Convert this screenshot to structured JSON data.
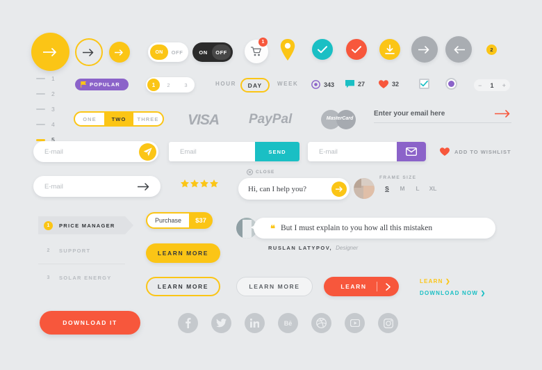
{
  "meta": {
    "kit_title": "Flat UI Kit Components",
    "colors": {
      "yellow": "#fbc516",
      "red": "#f7573c",
      "teal": "#1abfc4",
      "purple": "#8b63c9",
      "grey": "#a9adb2",
      "background": "#e8eaec"
    }
  },
  "row_arrows": {
    "arrow_big": "arrow-right-icon",
    "arrow_outline": "arrow-right-icon",
    "arrow_small": "arrow-right-icon"
  },
  "toggles": [
    {
      "name": "toggle-light",
      "on_label": "ON",
      "off_label": "OFF",
      "state": "on",
      "style": "light"
    },
    {
      "name": "toggle-dark",
      "on_label": "ON",
      "off_label": "OFF",
      "state": "off",
      "style": "dark"
    }
  ],
  "cart": {
    "icon": "shopping-cart-icon",
    "badge": "1"
  },
  "round_icons": [
    {
      "name": "map-pin-icon",
      "color": "#fbc516"
    },
    {
      "name": "check-icon",
      "color": "#1abfc4"
    },
    {
      "name": "check-icon",
      "color": "#f7573c"
    },
    {
      "name": "download-icon",
      "color": "#fbc516"
    },
    {
      "name": "arrow-right-icon",
      "color": "#a9adb2"
    },
    {
      "name": "arrow-left-icon",
      "color": "#a9adb2"
    }
  ],
  "notification_badge": {
    "count": "2"
  },
  "vertical_pager": {
    "items": [
      {
        "label": "1",
        "active": false
      },
      {
        "label": "2",
        "active": false
      },
      {
        "label": "3",
        "active": false
      },
      {
        "label": "4",
        "active": false
      },
      {
        "label": "5",
        "active": true
      }
    ]
  },
  "popular_badge": {
    "label": "POPULAR",
    "icon": "flag-icon"
  },
  "pagination": {
    "current": "1",
    "pages": [
      "2",
      "3"
    ]
  },
  "period_tabs": {
    "items": [
      {
        "label": "HOUR",
        "active": false
      },
      {
        "label": "DAY",
        "active": true
      },
      {
        "label": "WEEK",
        "active": false
      }
    ]
  },
  "stats": [
    {
      "icon": "eye-icon",
      "value": "343",
      "color": "#8b63c9"
    },
    {
      "icon": "comment-icon",
      "value": "27",
      "color": "#1abfc4"
    },
    {
      "icon": "heart-icon",
      "value": "32",
      "color": "#f7573c"
    }
  ],
  "checkbox": {
    "name": "checkbox",
    "checked": true
  },
  "radio": {
    "name": "radio-button",
    "checked": true
  },
  "stepper": {
    "minus": "−",
    "value": "1",
    "plus": "+"
  },
  "segmented": {
    "items": [
      {
        "label": "ONE",
        "active": false
      },
      {
        "label": "TWO",
        "active": true
      },
      {
        "label": "THREE",
        "active": false
      }
    ]
  },
  "payment_logos": [
    {
      "name": "visa-logo",
      "label": "VISA"
    },
    {
      "name": "paypal-logo",
      "label": "PayPal"
    },
    {
      "name": "mastercard-logo",
      "label": "MasterCard"
    }
  ],
  "email_underline": {
    "placeholder": "Enter your email here",
    "submit_icon": "arrow-right-icon"
  },
  "inputs": [
    {
      "name": "email-input-pill",
      "placeholder": "E-mail",
      "button": "send-plane-icon"
    },
    {
      "name": "email-input-send",
      "placeholder": "Email",
      "button_label": "SEND"
    },
    {
      "name": "email-input-envelope",
      "placeholder": "E-mail",
      "button": "envelope-icon"
    },
    {
      "name": "email-input-arrow",
      "placeholder": "E-mail",
      "button": "arrow-right-icon"
    }
  ],
  "wishlist": {
    "label": "ADD TO WISHLIST",
    "icon": "heart-icon"
  },
  "rating": {
    "stars_filled": 4,
    "stars_total": 4
  },
  "chat": {
    "close_label": "CLOSE",
    "close_icon": "close-circle-icon",
    "message": "Hi, can I help you?",
    "submit_icon": "arrow-right-icon"
  },
  "frame_size": {
    "title": "FRAME SIZE",
    "options": [
      {
        "label": "S",
        "active": true
      },
      {
        "label": "M",
        "active": false
      },
      {
        "label": "L",
        "active": false
      },
      {
        "label": "XL",
        "active": false
      }
    ]
  },
  "nav": {
    "items": [
      {
        "number": "1",
        "label": "PRICE MANAGER",
        "active": true
      },
      {
        "number": "2",
        "label": "SUPPORT",
        "active": false
      },
      {
        "number": "3",
        "label": "SOLAR ENERGY",
        "active": false
      }
    ]
  },
  "purchase": {
    "label": "Purchase",
    "price": "$37"
  },
  "buttons": [
    {
      "name": "learn-more-solid",
      "label": "LEARN MORE",
      "style": "solid-yellow"
    },
    {
      "name": "learn-more-outline",
      "label": "LEARN MORE",
      "style": "outline-yellow"
    },
    {
      "name": "learn-more-ghost",
      "label": "LEARN MORE",
      "style": "grey"
    },
    {
      "name": "learn-split",
      "label": "LEARN",
      "style": "solid-red",
      "icon": "chevron-right-icon"
    }
  ],
  "text_links": [
    {
      "name": "learn-link",
      "label": "LEARN",
      "arrow": "❯",
      "color": "#fbc516"
    },
    {
      "name": "download-now-link",
      "label": "DOWNLOAD NOW",
      "arrow": "❯",
      "color": "#1abfc4"
    }
  ],
  "testimonial": {
    "quote_icon": "quote-icon",
    "text": "But I must explain to you how all this mistaken",
    "author": "RUSLAN LATYPOV,",
    "role": "Designer",
    "avatar": "avatar-image"
  },
  "download_button": {
    "label": "DOWNLOAD IT"
  },
  "social": [
    {
      "name": "facebook-icon",
      "label": "f"
    },
    {
      "name": "twitter-icon",
      "label": "t"
    },
    {
      "name": "linkedin-icon",
      "label": "in"
    },
    {
      "name": "behance-icon",
      "label": "Bē"
    },
    {
      "name": "dribbble-icon",
      "label": "d"
    },
    {
      "name": "youtube-icon",
      "label": "yt"
    },
    {
      "name": "instagram-icon",
      "label": "ig"
    }
  ]
}
